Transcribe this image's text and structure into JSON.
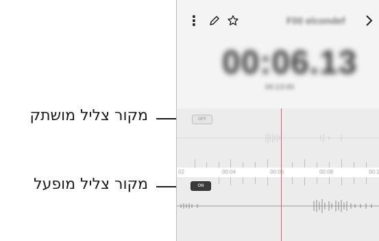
{
  "callouts": {
    "off_label": "מקור צליל מושתק",
    "on_label": "מקור צליל מופעל"
  },
  "header": {
    "more_icon": "more-vert-icon",
    "edit_icon": "pencil-icon",
    "star_icon": "star-outline-icon",
    "title": "F00 elcondef",
    "next_icon": "chevron-right-icon"
  },
  "recording": {
    "elapsed": "00:06.13",
    "date": "00:13:00"
  },
  "timeline": {
    "marks": [
      "02",
      "00:04",
      "00:06",
      "00:08",
      "00:1"
    ]
  },
  "tracks": {
    "off_toggle": "OFF",
    "on_toggle": "ON"
  },
  "colors": {
    "playhead": "#e05a66",
    "toggle_on": "#3b3b3b",
    "toggle_off": "#e4e4e4"
  }
}
